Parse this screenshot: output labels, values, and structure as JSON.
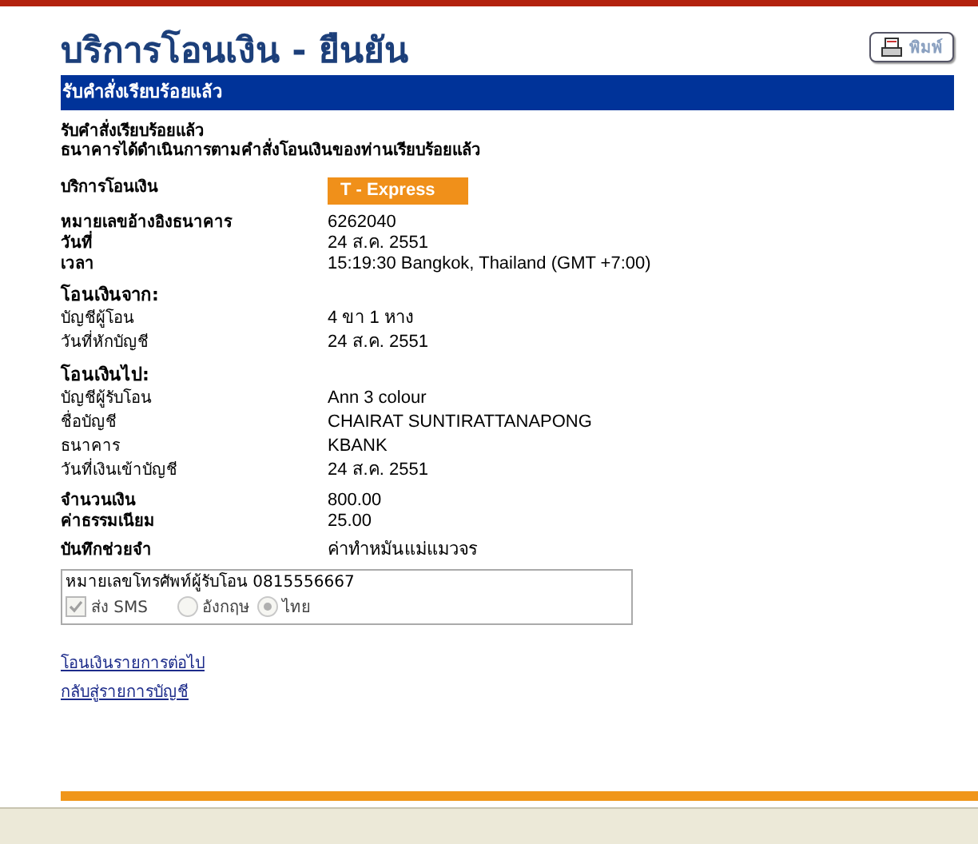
{
  "title": "บริการโอนเงิน - ยืนยัน",
  "print_button": "พิมพ์",
  "banner": "รับคำสั่งเรียบร้อยแล้ว",
  "messages": [
    "รับคำสั่งเรียบร้อยแล้ว",
    "ธนาคารได้ดำเนินการตามคำสั่งโอนเงินของท่านเรียบร้อยแล้ว"
  ],
  "groups": [
    {
      "rows": [
        {
          "kind": "badge",
          "label": "บริการโอนเงิน",
          "value": "T - Express"
        }
      ]
    },
    {
      "rows": [
        {
          "kind": "main",
          "label": "หมายเลขอ้างอิงธนาคาร",
          "value": "6262040"
        },
        {
          "kind": "main",
          "label": "วันที่",
          "value": "24 ส.ค. 2551"
        },
        {
          "kind": "main",
          "label": "เวลา",
          "value": "15:19:30 Bangkok, Thailand (GMT +7:00)"
        }
      ]
    },
    {
      "heading": "โอนเงินจาก:",
      "rows": [
        {
          "kind": "sub",
          "label": "บัญชีผู้โอน",
          "value": "4 ขา 1 หาง"
        },
        {
          "kind": "sub",
          "label": "วันที่หักบัญชี",
          "value": "24 ส.ค. 2551"
        }
      ]
    },
    {
      "heading": "โอนเงินไป:",
      "rows": [
        {
          "kind": "sub",
          "label": "บัญชีผู้รับโอน",
          "value": "Ann 3 colour"
        },
        {
          "kind": "sub",
          "label": "ชื่อบัญชี",
          "value": "CHAIRAT SUNTIRATTANAPONG"
        },
        {
          "kind": "sub",
          "label": "ธนาคาร",
          "value": "KBANK"
        },
        {
          "kind": "sub",
          "label": "วันที่เงินเข้าบัญชี",
          "value": "24 ส.ค. 2551"
        }
      ]
    },
    {
      "rows": [
        {
          "kind": "main",
          "label": "จำนวนเงิน",
          "value": "800.00"
        },
        {
          "kind": "main",
          "label": "ค่าธรรมเนียม",
          "value": "25.00"
        }
      ]
    },
    {
      "rows": [
        {
          "kind": "main",
          "label": "บันทึกช่วยจำ",
          "value": "ค่าทำหมันแม่แมวจร"
        }
      ]
    }
  ],
  "sms": {
    "phone": "หมายเลขโทรศัพท์ผู้รับโอน 0815556667",
    "send_sms": {
      "label": "ส่ง SMS",
      "checked": true
    },
    "languages": [
      {
        "label": "อังกฤษ",
        "selected": false
      },
      {
        "label": "ไทย",
        "selected": true
      }
    ]
  },
  "links": [
    "โอนเงินรายการต่อไป",
    "กลับสู่รายการบัญชี"
  ]
}
